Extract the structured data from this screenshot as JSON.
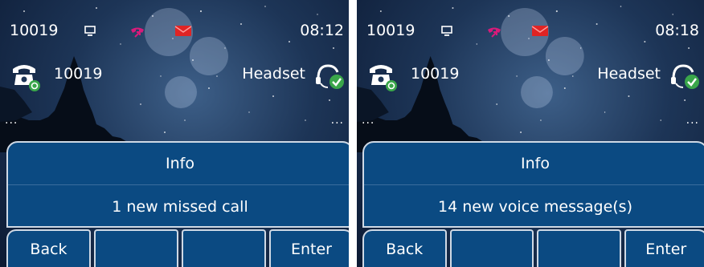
{
  "screens": [
    {
      "status_bar": {
        "extension": "10019",
        "time": "08:12",
        "icons": [
          "network-icon",
          "missed-call-icon",
          "voicemail-icon"
        ]
      },
      "line": {
        "label": "10019",
        "mode": "Headset",
        "icons": [
          "telephone-icon",
          "headset-icon"
        ]
      },
      "dialog": {
        "title": "Info",
        "message": "1 new missed call"
      },
      "softkeys": [
        "Back",
        "",
        "",
        "Enter"
      ],
      "more_indicator": "..."
    },
    {
      "status_bar": {
        "extension": "10019",
        "time": "08:18",
        "icons": [
          "network-icon",
          "missed-call-icon",
          "voicemail-icon"
        ]
      },
      "line": {
        "label": "10019",
        "mode": "Headset",
        "icons": [
          "telephone-icon",
          "headset-icon"
        ]
      },
      "dialog": {
        "title": "Info",
        "message": "14 new voice message(s)"
      },
      "softkeys": [
        "Back",
        "",
        "",
        "Enter"
      ],
      "more_indicator": "..."
    }
  ],
  "colors": {
    "dialog_bg": "#0b4a82",
    "dialog_border": "#cfd9e5",
    "missed_call": "#d81b7a",
    "voicemail": "#e02424",
    "headset_check": "#3aa64a"
  }
}
